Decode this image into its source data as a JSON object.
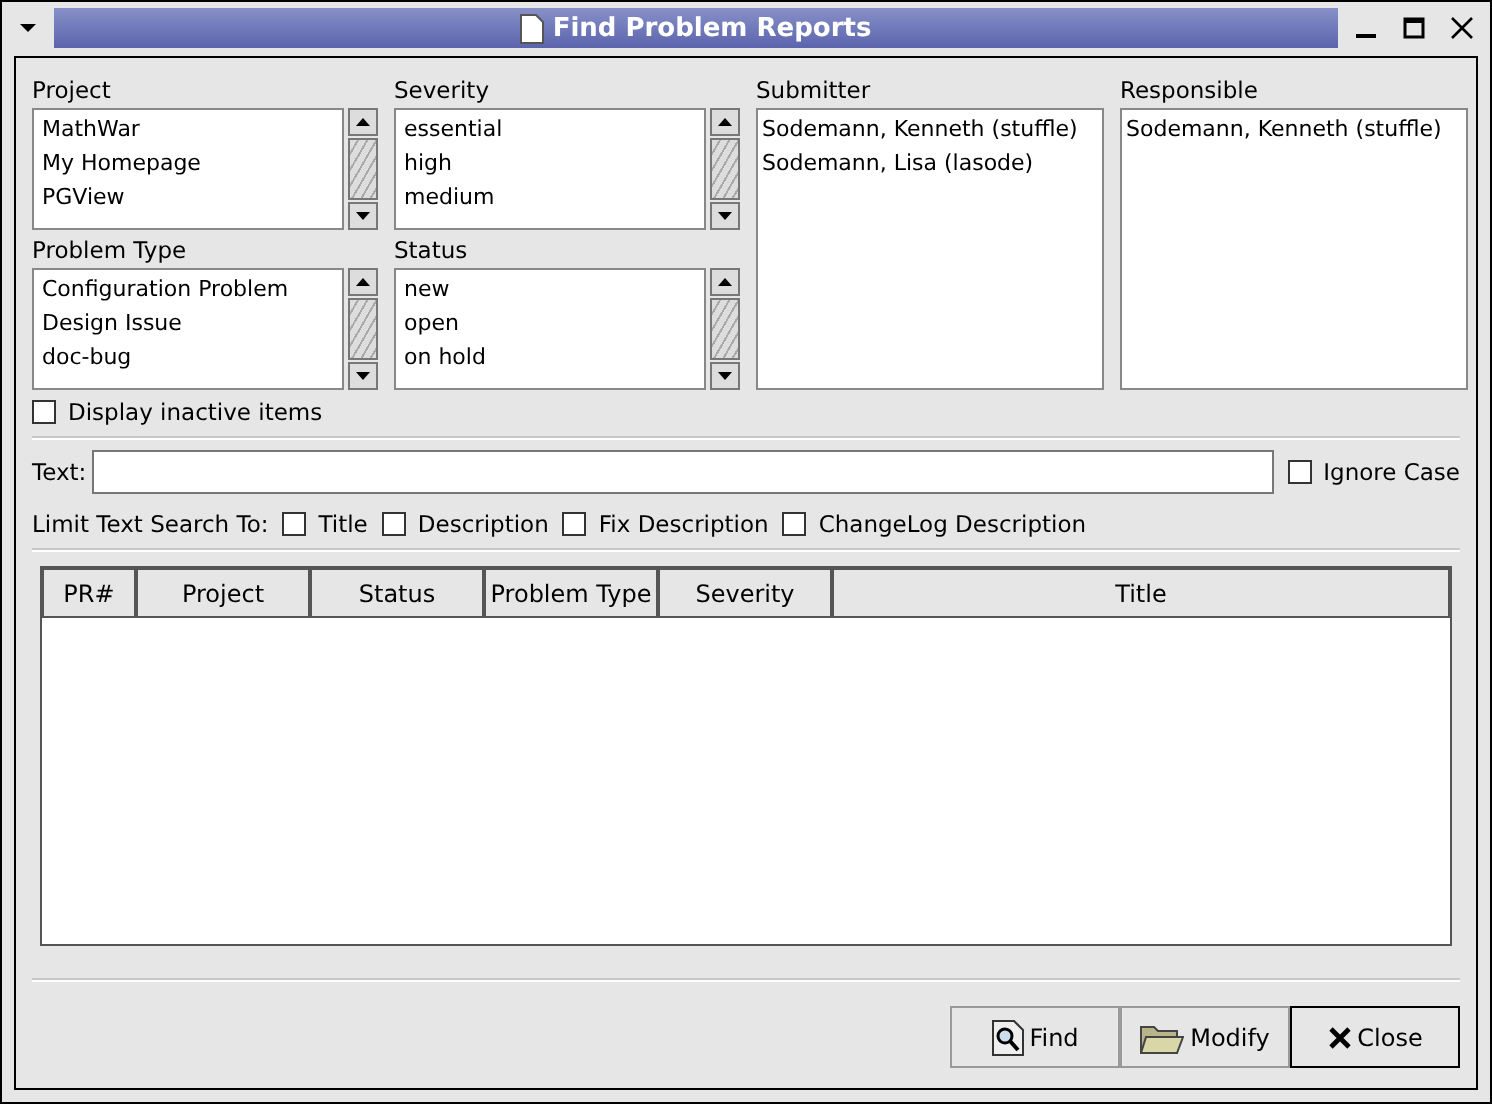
{
  "window": {
    "title": "Find Problem Reports"
  },
  "lists": [
    {
      "label": "Project",
      "items": [
        "MathWar",
        "My Homepage",
        "PGView"
      ],
      "kind": "scrolling"
    },
    {
      "label": "Severity",
      "items": [
        "essential",
        "high",
        "medium"
      ],
      "kind": "scrolling"
    },
    {
      "label": "Submitter",
      "items": [
        "Sodemann, Kenneth (stuffle)",
        "Sodemann, Lisa (lasode)"
      ],
      "kind": "tall"
    },
    {
      "label": "Responsible",
      "items": [
        "Sodemann, Kenneth (stuffle)"
      ],
      "kind": "tall"
    },
    {
      "label": "Problem Type",
      "items": [
        "Configuration Problem",
        "Design Issue",
        "doc-bug"
      ],
      "kind": "scrolling"
    },
    {
      "label": "Status",
      "items": [
        "new",
        "open",
        "on hold"
      ],
      "kind": "scrolling"
    }
  ],
  "display_inactive": {
    "label": "Display inactive items",
    "checked": false
  },
  "text_field": {
    "label": "Text:"
  },
  "ignore_case": {
    "label": "Ignore Case",
    "checked": false
  },
  "limit": {
    "label": "Limit Text Search To:",
    "options": [
      {
        "label": "Title",
        "checked": false
      },
      {
        "label": "Description",
        "checked": false
      },
      {
        "label": "Fix Description",
        "checked": false
      },
      {
        "label": "ChangeLog Description",
        "checked": false
      }
    ]
  },
  "table": {
    "columns": [
      "PR#",
      "Project",
      "Status",
      "Problem Type",
      "Severity",
      "Title"
    ]
  },
  "buttons": [
    {
      "label": "Find",
      "kind": "find",
      "default": false
    },
    {
      "label": "Modify",
      "kind": "modify",
      "default": false
    },
    {
      "label": "Close",
      "kind": "close",
      "default": true
    }
  ]
}
